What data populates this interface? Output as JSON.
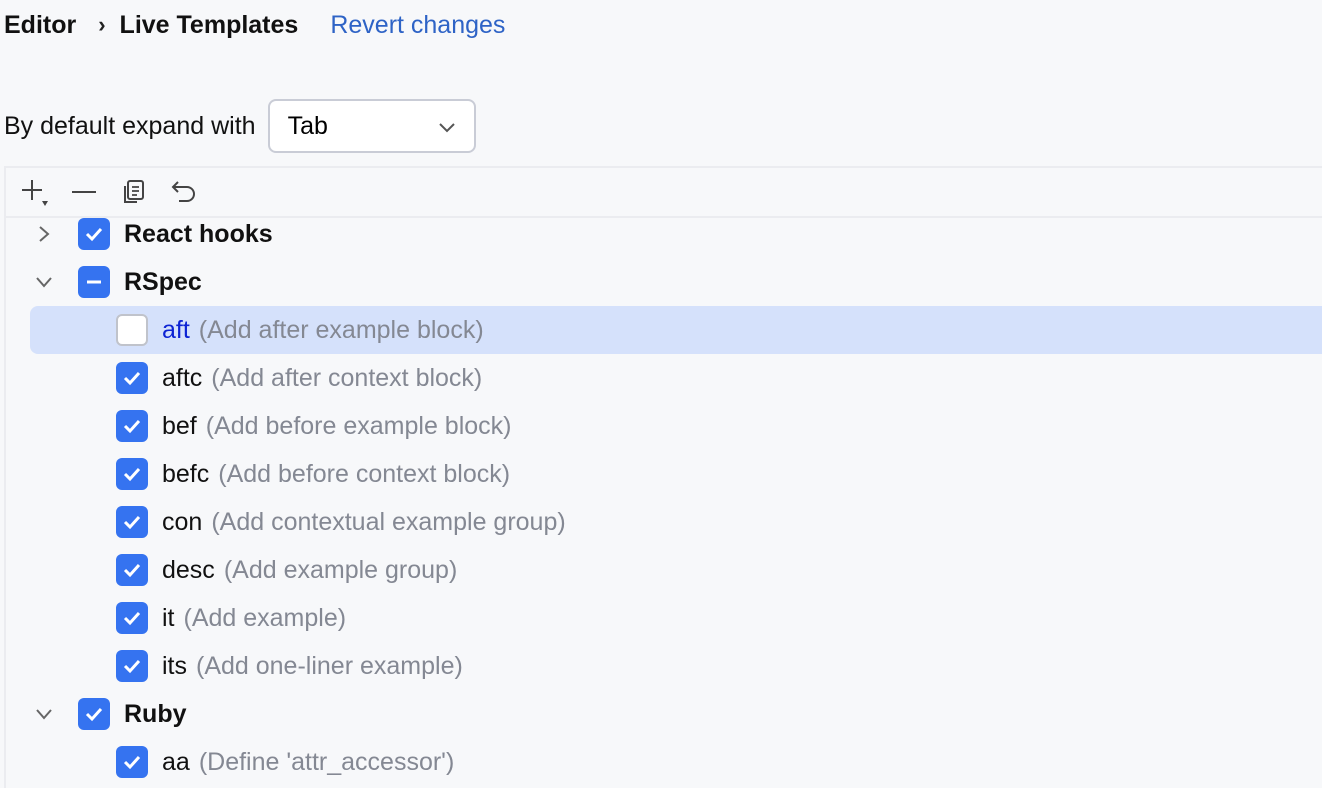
{
  "breadcrumb": {
    "parent": "Editor",
    "separator": "›",
    "current": "Live Templates",
    "revert_label": "Revert changes"
  },
  "expand": {
    "label": "By default expand with",
    "value": "Tab"
  },
  "toolbar": {
    "icons": [
      "add-icon",
      "remove-icon",
      "copy-icon",
      "restore-icon"
    ]
  },
  "colors": {
    "accent": "#3573f0",
    "link": "#2e63c6",
    "selection": "#d5e1fb",
    "description": "#848893"
  },
  "tree": {
    "groups": [
      {
        "name": "React hooks",
        "state": "checked",
        "expanded": false,
        "items": []
      },
      {
        "name": "RSpec",
        "state": "partial",
        "expanded": true,
        "items": [
          {
            "abbr": "aft",
            "desc": "(Add after example block)",
            "checked": false,
            "selected": true
          },
          {
            "abbr": "aftc",
            "desc": "(Add after context block)",
            "checked": true
          },
          {
            "abbr": "bef",
            "desc": "(Add before example block)",
            "checked": true
          },
          {
            "abbr": "befc",
            "desc": "(Add before context block)",
            "checked": true
          },
          {
            "abbr": "con",
            "desc": "(Add contextual example group)",
            "checked": true
          },
          {
            "abbr": "desc",
            "desc": "(Add example group)",
            "checked": true
          },
          {
            "abbr": "it",
            "desc": "(Add example)",
            "checked": true
          },
          {
            "abbr": "its",
            "desc": "(Add one-liner example)",
            "checked": true
          }
        ]
      },
      {
        "name": "Ruby",
        "state": "checked",
        "expanded": true,
        "items": [
          {
            "abbr": "aa",
            "desc": "(Define 'attr_accessor')",
            "checked": true
          }
        ]
      }
    ]
  }
}
